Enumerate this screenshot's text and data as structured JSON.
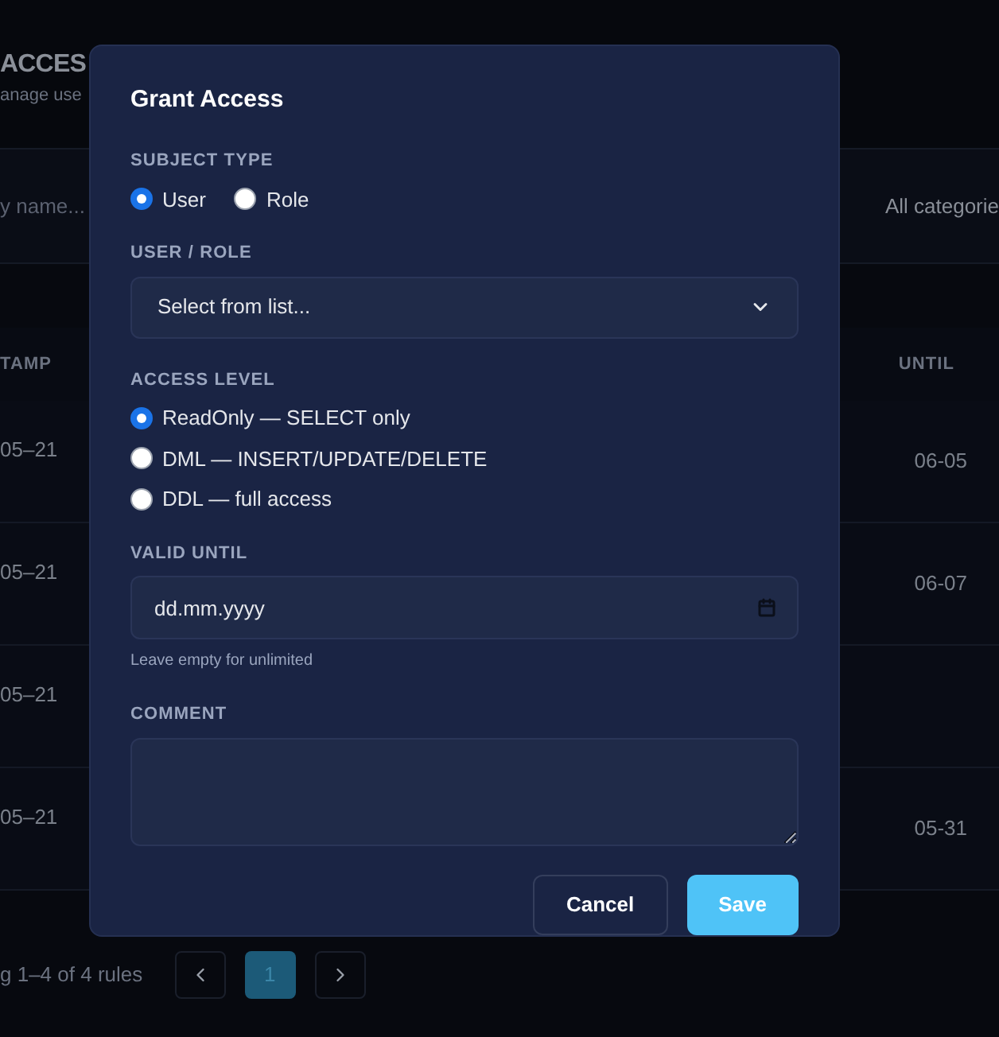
{
  "background": {
    "title": "ACCES",
    "subtitle": "anage use",
    "search": {
      "placeholder": "y name..."
    },
    "category_filter": "All categorie",
    "columns": [
      "TAMP",
      "UNTIL"
    ],
    "rows": [
      {
        "column_1": "05–21",
        "column_2": "06-05"
      },
      {
        "column_1": "05–21",
        "column_2": "06-07"
      },
      {
        "column_1": "05–21"
      },
      {
        "column_1": "05–21",
        "column_2": "05-31"
      }
    ],
    "footer": {
      "summary": "g 1–4 of 4 rules",
      "pages": [
        {
          "label": "1",
          "selected": true
        }
      ]
    }
  },
  "dialog": {
    "title": "Grant Access",
    "subject_type": {
      "label": "SUBJECT TYPE",
      "options": [
        {
          "label": "User",
          "selected": true
        },
        {
          "label": "Role",
          "selected": false
        }
      ]
    },
    "user_role": {
      "label": "USER / ROLE",
      "value": "Select from list..."
    },
    "access_level": {
      "label": "ACCESS LEVEL",
      "options": [
        {
          "label": "ReadOnly — SELECT only",
          "selected": true
        },
        {
          "label": "DML — INSERT/UPDATE/DELETE",
          "selected": false
        },
        {
          "label": "DDL — full access",
          "selected": false
        }
      ]
    },
    "valid_until": {
      "label": "VALID UNTIL",
      "placeholder": "dd.mm.yyyy",
      "hint": "Leave empty for unlimited"
    },
    "comment": {
      "label": "COMMENT"
    },
    "buttons": {
      "cancel": "Cancel",
      "save": "Save"
    }
  }
}
